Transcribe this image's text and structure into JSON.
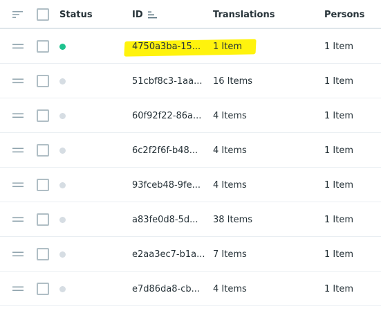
{
  "header": {
    "status": "Status",
    "id": "ID",
    "translations": "Translations",
    "persons": "Persons"
  },
  "icons": {
    "sort_list": "sort-list-icon",
    "sort_ascending": "sort-ascending-icon",
    "drag_handle": "drag-handle-icon"
  },
  "colors": {
    "status_active": "#1ec28e",
    "status_inactive": "#d6dde3",
    "highlight": "#fff200"
  },
  "rows": [
    {
      "status": "active",
      "id": "4750a3ba-15...",
      "translations": "1 Item",
      "persons": "1 Item"
    },
    {
      "status": "inactive",
      "id": "51cbf8c3-1aa...",
      "translations": "16 Items",
      "persons": "1 Item"
    },
    {
      "status": "inactive",
      "id": "60f92f22-86a...",
      "translations": "4 Items",
      "persons": "1 Item"
    },
    {
      "status": "inactive",
      "id": "6c2f2f6f-b48...",
      "translations": "4 Items",
      "persons": "1 Item"
    },
    {
      "status": "inactive",
      "id": "93fceb48-9fe...",
      "translations": "4 Items",
      "persons": "1 Item"
    },
    {
      "status": "inactive",
      "id": "a83fe0d8-5d...",
      "translations": "38 Items",
      "persons": "1 Item"
    },
    {
      "status": "inactive",
      "id": "e2aa3ec7-b1a...",
      "translations": "7 Items",
      "persons": "1 Item"
    },
    {
      "status": "inactive",
      "id": "e7d86da8-cb...",
      "translations": "4 Items",
      "persons": "1 Item"
    }
  ]
}
